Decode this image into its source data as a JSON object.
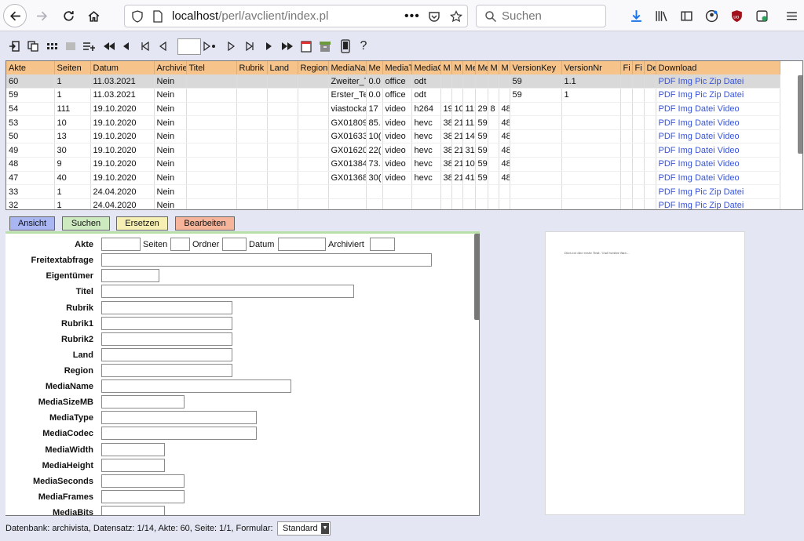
{
  "browser": {
    "url_host": "localhost",
    "url_path": "/perl/avclient/index.pl",
    "search_placeholder": "Suchen"
  },
  "toolbar": {
    "record_input_value": "",
    "help_label": "?"
  },
  "grid": {
    "columns": [
      "Akte",
      "Seiten",
      "Datum",
      "Archivie",
      "Titel",
      "Rubrik",
      "Land",
      "Region",
      "MediaNa",
      "Me",
      "MediaT",
      "MediaC",
      "M",
      "M",
      "Me",
      "Me",
      "M",
      "M",
      "VersionKey",
      "VersionNr",
      "Fi",
      "Fi",
      "De",
      "Download"
    ],
    "rows": [
      [
        "60",
        "1",
        "11.03.2021",
        "Nein",
        "",
        "",
        "",
        "",
        "Zweiter_T",
        "0.0",
        "office",
        "odt",
        "",
        "",
        "",
        "",
        "",
        "",
        "59",
        "1.1",
        "",
        "",
        "",
        "PDF Img Pic Zip Datei"
      ],
      [
        "59",
        "1",
        "11.03.2021",
        "Nein",
        "",
        "",
        "",
        "",
        "Erster_Te",
        "0.0",
        "office",
        "odt",
        "",
        "",
        "",
        "",
        "",
        "",
        "59",
        "1",
        "",
        "",
        "",
        "PDF Img Pic Zip Datei"
      ],
      [
        "54",
        "111",
        "19.10.2020",
        "Nein",
        "",
        "",
        "",
        "",
        "viastocka",
        "17",
        "video",
        "h264",
        "19",
        "10",
        "11:",
        "29.",
        "8",
        "48",
        "",
        "",
        "",
        "",
        "",
        "PDF Img Datei Video"
      ],
      [
        "53",
        "10",
        "19.10.2020",
        "Nein",
        "",
        "",
        "",
        "",
        "GX01809",
        "85.",
        "video",
        "hevc",
        "38",
        "21",
        "11.",
        "59.",
        "",
        "48",
        "",
        "",
        "",
        "",
        "",
        "PDF Img Datei Video"
      ],
      [
        "50",
        "13",
        "19.10.2020",
        "Nein",
        "",
        "",
        "",
        "",
        "GX01633",
        "10(",
        "video",
        "hevc",
        "38",
        "21",
        "14.",
        "59.",
        "",
        "48",
        "",
        "",
        "",
        "",
        "",
        "PDF Img Datei Video"
      ],
      [
        "49",
        "30",
        "19.10.2020",
        "Nein",
        "",
        "",
        "",
        "",
        "GX01620",
        "22(",
        "video",
        "hevc",
        "38",
        "21",
        "31.",
        "59.",
        "",
        "48",
        "",
        "",
        "",
        "",
        "",
        "PDF Img Datei Video"
      ],
      [
        "48",
        "9",
        "19.10.2020",
        "Nein",
        "",
        "",
        "",
        "",
        "GX01384",
        "73.",
        "video",
        "hevc",
        "38",
        "21",
        "10.",
        "59.",
        "",
        "48",
        "",
        "",
        "",
        "",
        "",
        "PDF Img Datei Video"
      ],
      [
        "47",
        "40",
        "19.10.2020",
        "Nein",
        "",
        "",
        "",
        "",
        "GX01368",
        "30(",
        "video",
        "hevc",
        "38",
        "21",
        "41.",
        "59.",
        "",
        "48",
        "",
        "",
        "",
        "",
        "",
        "PDF Img Datei Video"
      ],
      [
        "33",
        "1",
        "24.04.2020",
        "Nein",
        "",
        "",
        "",
        "",
        "",
        "",
        "",
        "",
        "",
        "",
        "",
        "",
        "",
        "",
        "",
        "",
        "",
        "",
        "",
        "PDF Img Pic Zip Datei"
      ],
      [
        "32",
        "1",
        "24.04.2020",
        "Nein",
        "",
        "",
        "",
        "",
        "",
        "",
        "",
        "",
        "",
        "",
        "",
        "",
        "",
        "",
        "",
        "",
        "",
        "",
        "",
        "PDF Img Pic Zip Datei"
      ]
    ]
  },
  "tabs": [
    {
      "label": "Ansicht",
      "color": "#a9b6f2"
    },
    {
      "label": "Suchen",
      "color": "#cde9c0"
    },
    {
      "label": "Ersetzen",
      "color": "#f6efb3"
    },
    {
      "label": "Bearbeiten",
      "color": "#f6b59b"
    }
  ],
  "form": {
    "row1": {
      "akte": "Akte",
      "seiten": "Seiten",
      "ordner": "Ordner",
      "datum": "Datum",
      "archiviert": "Archiviert"
    },
    "fields": [
      "Freitextabfrage",
      "Eigentümer",
      "Titel",
      "Rubrik",
      "Rubrik1",
      "Rubrik2",
      "Land",
      "Region",
      "MediaName",
      "MediaSizeMB",
      "MediaType",
      "MediaCodec",
      "MediaWidth",
      "MediaHeight",
      "MediaSeconds",
      "MediaFrames",
      "MediaBits"
    ]
  },
  "preview": {
    "text": "Dies ist der erste Text. Und weiter fine..."
  },
  "status": {
    "text": "Datenbank: archivista, Datensatz: 1/14, Akte: 60, Seite: 1/1, Formular:",
    "form_value": "Standard"
  }
}
